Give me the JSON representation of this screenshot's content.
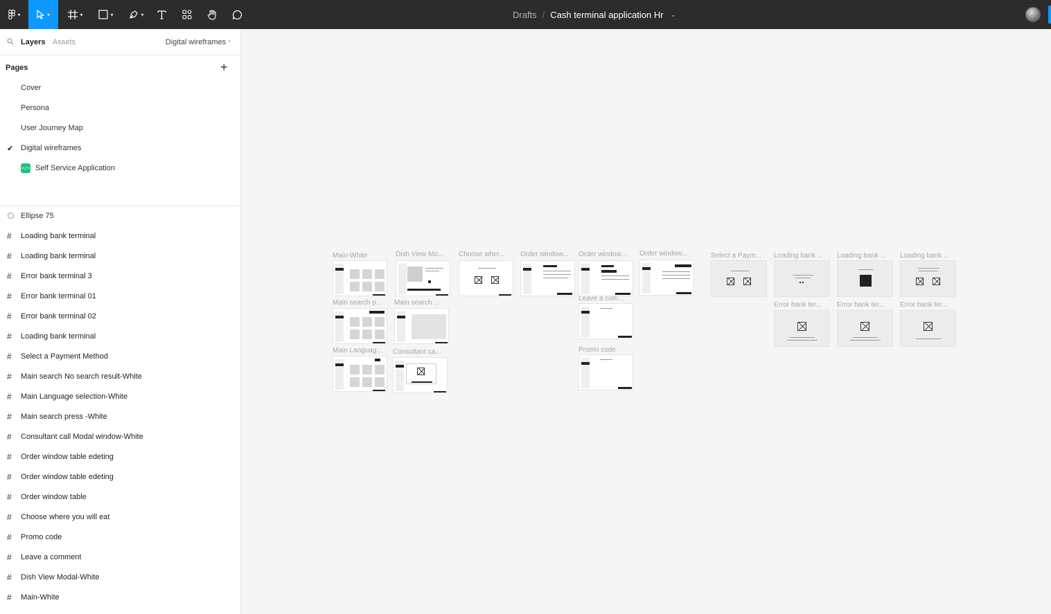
{
  "toolbar": {
    "breadcrumb_root": "Drafts",
    "breadcrumb_sep": "/",
    "file_name": "Cash terminal application Hr"
  },
  "sidebar": {
    "tab_layers": "Layers",
    "tab_assets": "Assets",
    "current_page": "Digital wireframes",
    "pages_title": "Pages",
    "pages": [
      {
        "label": "Cover"
      },
      {
        "label": "Persona"
      },
      {
        "label": "User Journey Map"
      },
      {
        "label": "Digital wireframes",
        "selected": true
      },
      {
        "label": "Self Service Application"
      }
    ],
    "layers": [
      {
        "label": "Ellipse 75",
        "type": "ellipse"
      },
      {
        "label": "Loading bank terminal",
        "type": "frame"
      },
      {
        "label": "Loading bank terminal",
        "type": "frame"
      },
      {
        "label": "Error bank terminal 3",
        "type": "frame"
      },
      {
        "label": "Error bank terminal 01",
        "type": "frame"
      },
      {
        "label": "Error bank terminal 02",
        "type": "frame"
      },
      {
        "label": "Loading bank terminal",
        "type": "frame"
      },
      {
        "label": "Select a Payment Method",
        "type": "frame"
      },
      {
        "label": "Main search No search result-White",
        "type": "frame"
      },
      {
        "label": "Main Language selection-White",
        "type": "frame"
      },
      {
        "label": "Main search press -White",
        "type": "frame"
      },
      {
        "label": "Consultant call Modal window-White",
        "type": "frame"
      },
      {
        "label": "Order window table edeting",
        "type": "frame"
      },
      {
        "label": "Order window table edeting",
        "type": "frame"
      },
      {
        "label": "Order window table",
        "type": "frame"
      },
      {
        "label": "Choose where you will eat",
        "type": "frame"
      },
      {
        "label": "Promo code",
        "type": "frame"
      },
      {
        "label": "Leave a comment",
        "type": "frame"
      },
      {
        "label": "Dish View Modal-White",
        "type": "frame"
      },
      {
        "label": "Main-White",
        "type": "frame"
      }
    ]
  },
  "canvas": {
    "frame_labels": {
      "main_white": "Main-White",
      "dish_view": "Dish View Mo...",
      "choose_where": "Choose wher...",
      "order_window_1": "Order window...",
      "order_window_2": "Order window...",
      "order_window_3": "Order window...",
      "select_payment": "Select a Paym...",
      "loading_1": "Loading bank ...",
      "loading_2": "Loading bank ...",
      "loading_3": "Loading bank ...",
      "main_search_p": "Main search p...",
      "main_search_2": "Main search ...",
      "leave_comment": "Leave a com...",
      "error_1": "Error bank ter...",
      "error_2": "Error bank ter...",
      "error_3": "Error bank ter...",
      "main_language": "Main Languag...",
      "consultant": "Consultant ca...",
      "promo": "Promo code"
    }
  }
}
